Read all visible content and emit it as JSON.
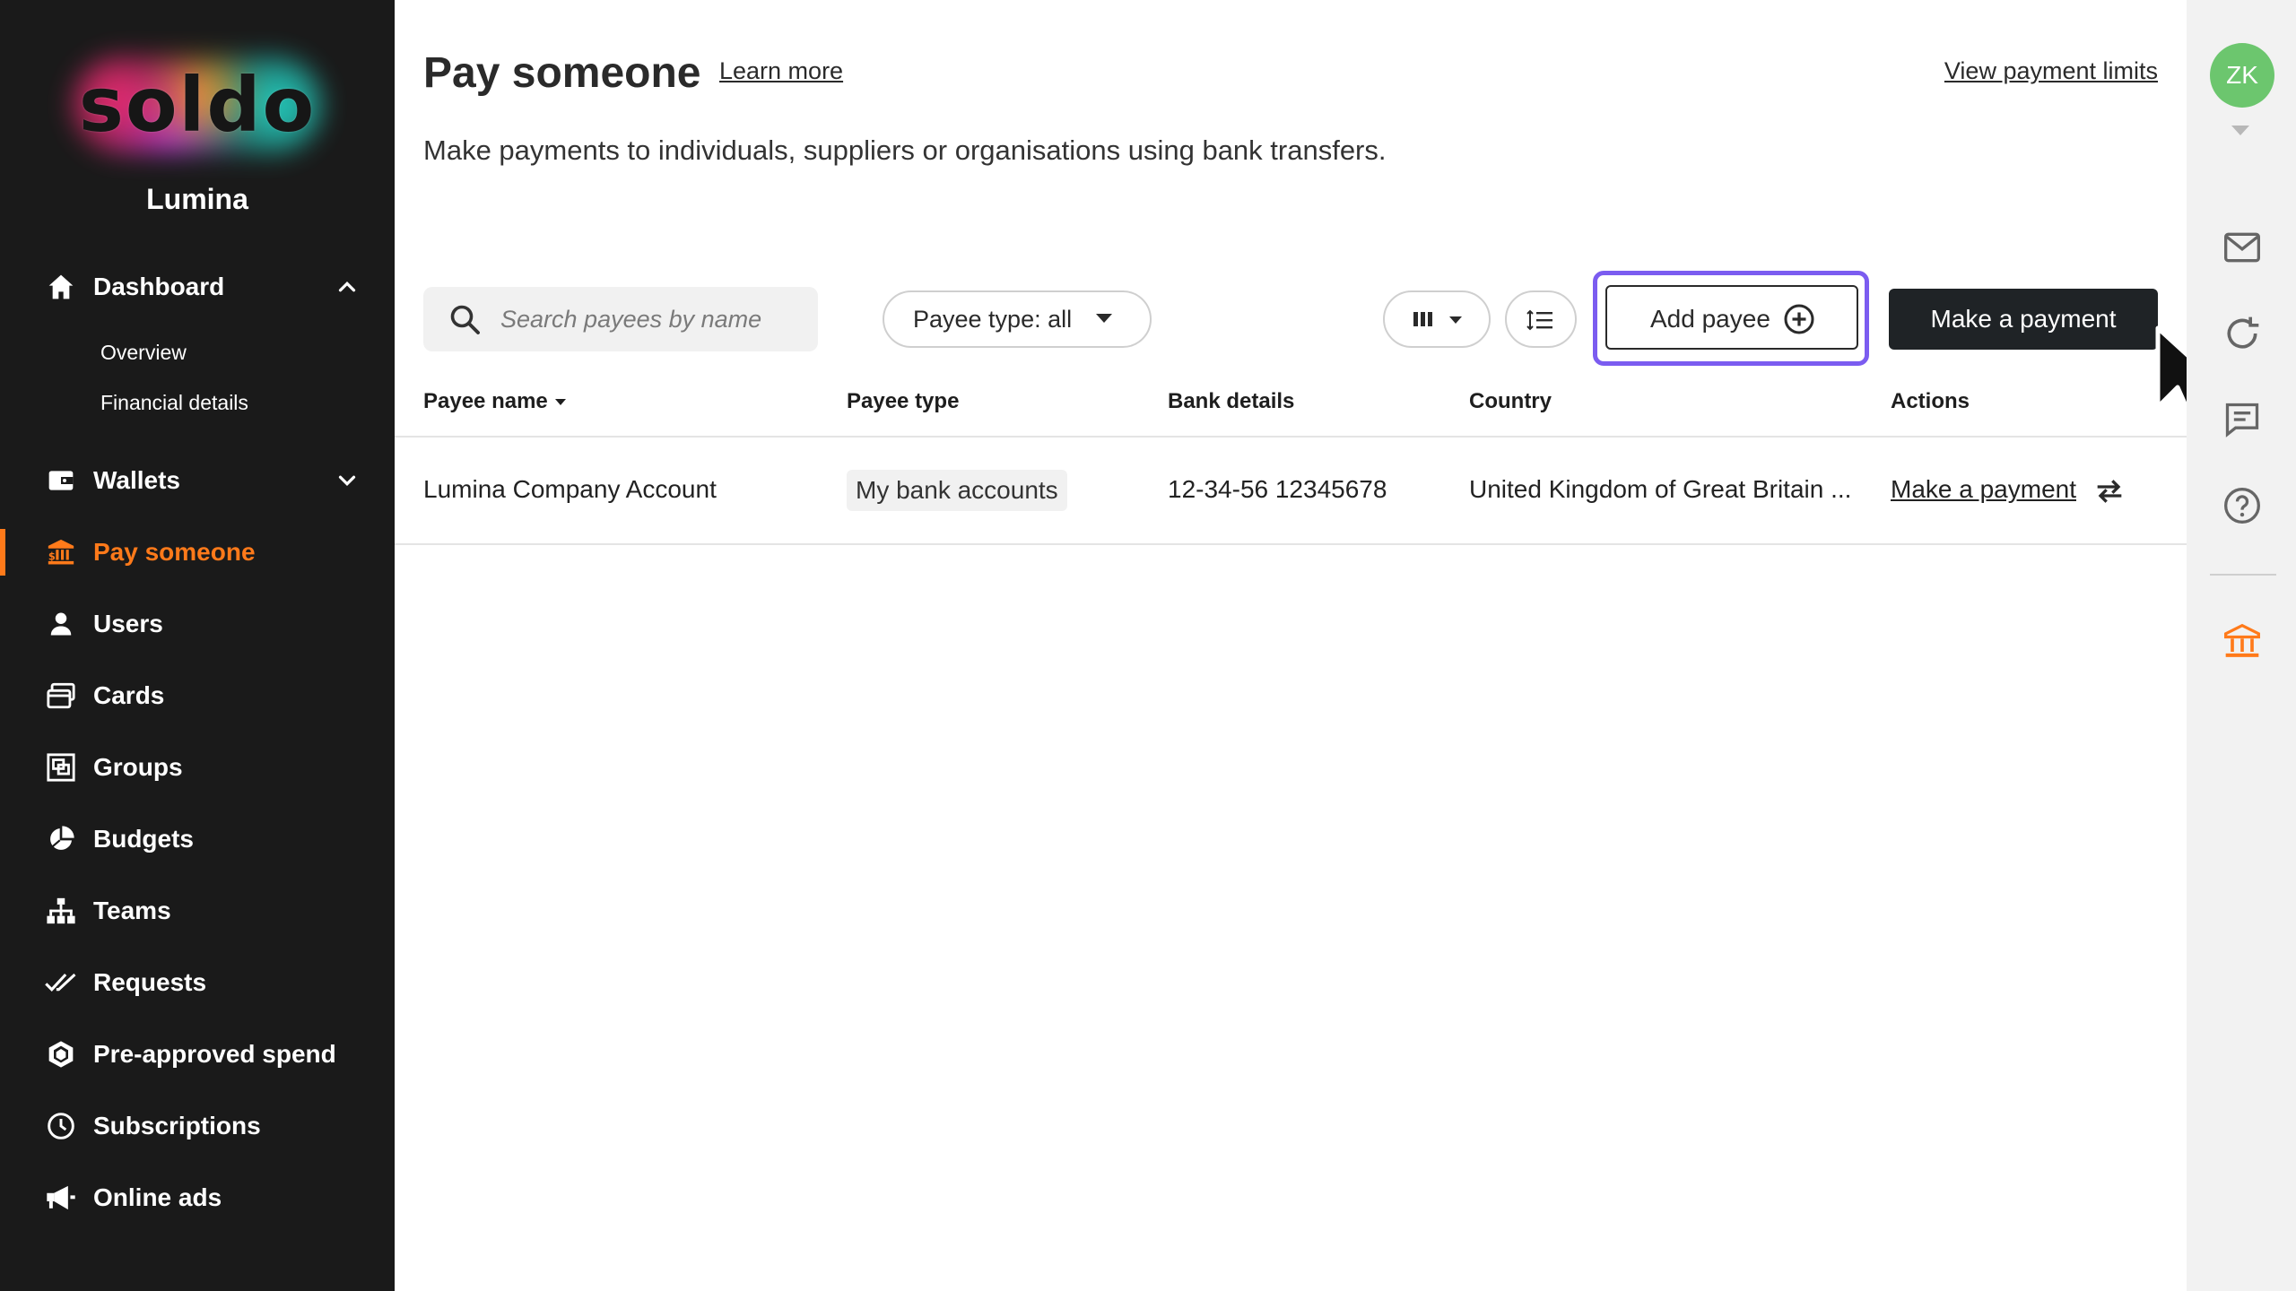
{
  "brand": {
    "logo_text": "soldo",
    "org_name": "Lumina"
  },
  "sidebar": {
    "dashboard": {
      "label": "Dashboard",
      "subitems": [
        "Overview",
        "Financial details"
      ]
    },
    "items": [
      {
        "label": "Wallets",
        "icon": "wallet-icon"
      },
      {
        "label": "Pay someone",
        "icon": "bank-pay-icon",
        "active": true
      },
      {
        "label": "Users",
        "icon": "user-icon"
      },
      {
        "label": "Cards",
        "icon": "cards-icon"
      },
      {
        "label": "Groups",
        "icon": "groups-icon"
      },
      {
        "label": "Budgets",
        "icon": "pie-chart-icon"
      },
      {
        "label": "Teams",
        "icon": "org-chart-icon"
      },
      {
        "label": "Requests",
        "icon": "double-check-icon"
      },
      {
        "label": "Pre-approved spend",
        "icon": "hexagon-icon"
      },
      {
        "label": "Subscriptions",
        "icon": "clock-icon"
      },
      {
        "label": "Online ads",
        "icon": "megaphone-icon"
      }
    ],
    "accent_color": "#ff7a1a"
  },
  "header": {
    "title": "Pay someone",
    "learn_more": "Learn more",
    "view_limits": "View payment limits",
    "subtitle": "Make payments to individuals, suppliers or organisations using bank transfers."
  },
  "toolbar": {
    "search_placeholder": "Search payees by name",
    "payee_type_filter": "Payee type: all",
    "add_payee": "Add payee",
    "make_payment": "Make a payment"
  },
  "table": {
    "columns": [
      "Payee name",
      "Payee type",
      "Bank details",
      "Country",
      "Actions"
    ],
    "rows": [
      {
        "payee_name": "Lumina Company Account",
        "payee_type": "My bank accounts",
        "bank_details": "12-34-56 12345678",
        "country": "United Kingdom of Great Britain ...",
        "action": "Make a payment"
      }
    ]
  },
  "user": {
    "initials": "ZK",
    "avatar_color": "#6cc66e"
  },
  "focus_color": "#7b5cf0"
}
